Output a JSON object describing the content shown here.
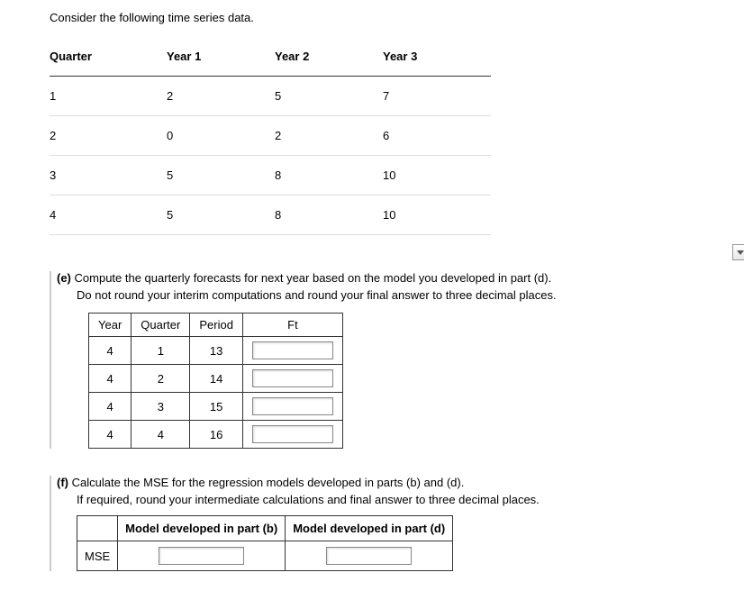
{
  "intro": "Consider the following time series data.",
  "data_headers": [
    "Quarter",
    "Year 1",
    "Year 2",
    "Year 3"
  ],
  "data_rows": [
    {
      "q": "1",
      "y1": "2",
      "y2": "5",
      "y3": "7"
    },
    {
      "q": "2",
      "y1": "0",
      "y2": "2",
      "y3": "6"
    },
    {
      "q": "3",
      "y1": "5",
      "y2": "8",
      "y3": "10"
    },
    {
      "q": "4",
      "y1": "5",
      "y2": "8",
      "y3": "10"
    }
  ],
  "e": {
    "label": "(e)",
    "line1": "Compute the quarterly forecasts for next year based on the model you developed in part (d).",
    "line2": "Do not round your interim computations and round your final answer to three decimal places.",
    "headers": [
      "Year",
      "Quarter",
      "Period",
      "Ft"
    ],
    "rows": [
      {
        "year": "4",
        "quarter": "1",
        "period": "13"
      },
      {
        "year": "4",
        "quarter": "2",
        "period": "14"
      },
      {
        "year": "4",
        "quarter": "3",
        "period": "15"
      },
      {
        "year": "4",
        "quarter": "4",
        "period": "16"
      }
    ]
  },
  "f": {
    "label": "(f)",
    "line1": "Calculate the MSE for the regression models developed in parts (b) and (d).",
    "line2": "If required, round your intermediate calculations and final answer to three decimal places.",
    "h1": "Model developed in part (b)",
    "h2": "Model developed in part (d)",
    "row_label": "MSE"
  }
}
